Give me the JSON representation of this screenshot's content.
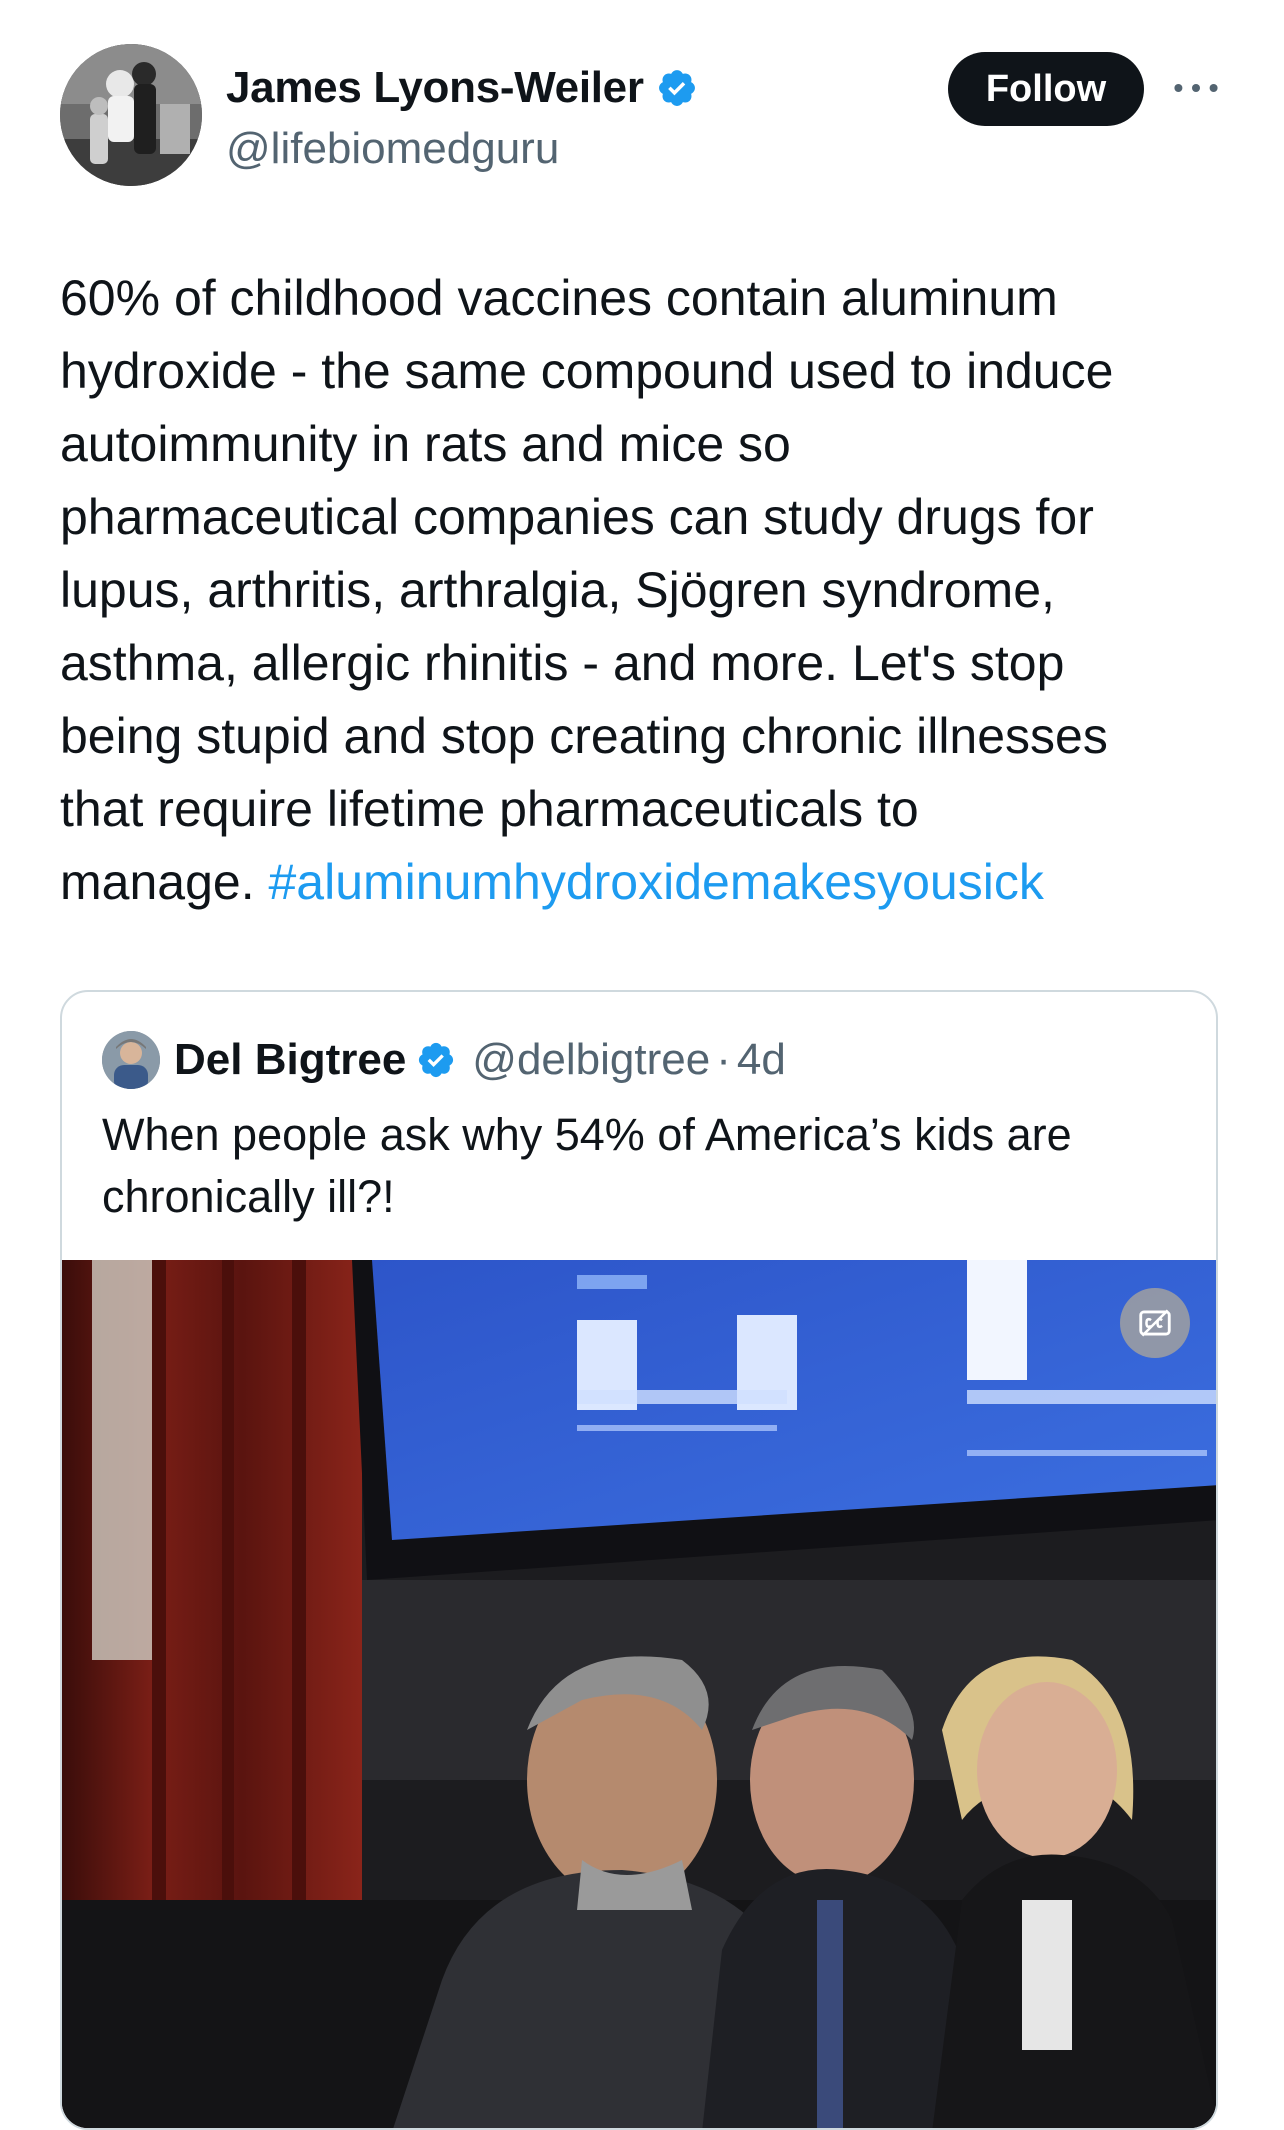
{
  "author": {
    "name": "James Lyons-Weiler",
    "handle": "@lifebiomedguru",
    "verified": true
  },
  "actions": {
    "follow_label": "Follow",
    "more_icon": "more-horizontal-icon"
  },
  "tweet": {
    "text": "60% of childhood vaccines contain aluminum\nhydroxide - the same compound used to induce\nautoimmunity in rats and mice so\npharmaceutical companies can study drugs for\nlupus, arthritis, arthralgia, Sjögren syndrome,\nasthma, allergic rhinitis - and more. Let's stop\nbeing stupid and stop creating chronic illnesses\nthat require lifetime pharmaceuticals to\nmanage. ",
    "hashtag": "#aluminumhydroxidemakesyousick"
  },
  "quoted": {
    "name": "Del Bigtree",
    "handle": "@delbigtree",
    "separator": "·",
    "time": "4d",
    "text": "When people ask why 54% of America’s kids are chronically ill?!",
    "captions_icon": "closed-captions-icon"
  },
  "colors": {
    "link": "#1d9bf0",
    "verified": "#1d9bf0",
    "text": "#0f1419",
    "secondary": "#536471",
    "follow_bg": "#0f1419"
  }
}
